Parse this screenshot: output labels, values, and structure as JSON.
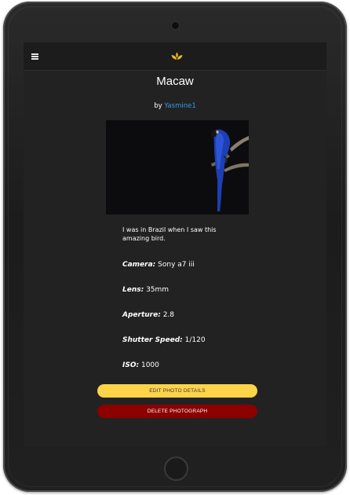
{
  "header": {
    "menu_icon": "hamburger-menu-icon",
    "logo_icon": "lotus-logo-icon",
    "logo_color": "#f0b91e"
  },
  "photo": {
    "title": "Macaw",
    "byline_prefix": "by",
    "author": "Yasmine1",
    "image_alt": "Blue macaw perched on a branch",
    "description": "I was in Brazil when I saw this amazing bird."
  },
  "details": [
    {
      "label": "Camera:",
      "value": "Sony a7 iii"
    },
    {
      "label": "Lens:",
      "value": "35mm"
    },
    {
      "label": "Aperture:",
      "value": "2.8"
    },
    {
      "label": "Shutter Speed:",
      "value": "1/120"
    },
    {
      "label": "ISO:",
      "value": "1000"
    }
  ],
  "actions": {
    "edit_label": "EDIT PHOTO DETAILS",
    "delete_label": "DELETE PHOTOGRAPH"
  },
  "colors": {
    "screen_bg": "#222222",
    "link": "#2e9bea",
    "edit_button": "#fdd34a",
    "delete_button": "#8c0000"
  }
}
